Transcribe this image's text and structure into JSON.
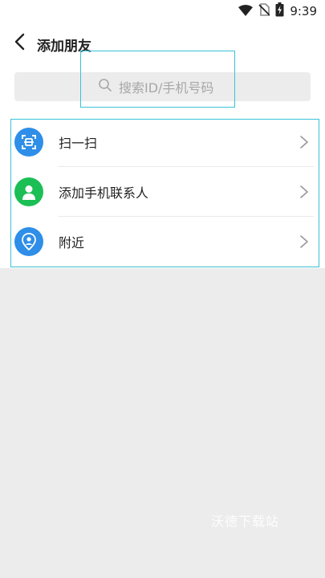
{
  "status_bar": {
    "time": "9:39",
    "icons": [
      "wifi-icon",
      "no-sim-icon",
      "battery-charging-icon"
    ]
  },
  "header": {
    "title": "添加朋友",
    "back_icon": "chevron-left-icon"
  },
  "search": {
    "placeholder": "搜索ID/手机号码",
    "icon": "search-icon"
  },
  "menu": {
    "items": [
      {
        "label": "扫一扫",
        "icon": "scan-icon",
        "icon_color": "#2e8ee8"
      },
      {
        "label": "添加手机联系人",
        "icon": "contact-person-icon",
        "icon_color": "#1bbf55"
      },
      {
        "label": "附近",
        "icon": "location-pin-icon",
        "icon_color": "#2e8ee8"
      }
    ],
    "arrow_icon": "chevron-right-icon"
  },
  "watermark": {
    "text": "沃德下载站"
  },
  "colors": {
    "highlight": "#39c2d6",
    "background": "#ececec",
    "blue": "#2e8ee8",
    "green": "#1bbf55"
  }
}
